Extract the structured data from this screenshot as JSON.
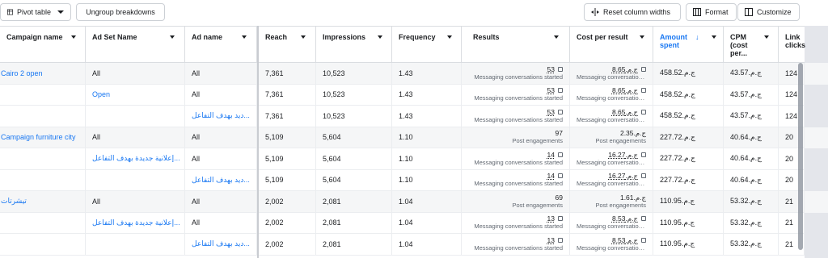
{
  "toolbar": {
    "pivot_label": "Pivot table",
    "ungroup_label": "Ungroup breakdowns",
    "reset_label": "Reset column widths",
    "format_label": "Format",
    "customize_label": "Customize"
  },
  "columns": {
    "campaign": "Campaign name",
    "adset": "Ad Set Name",
    "adname": "Ad name",
    "reach": "Reach",
    "impressions": "Impressions",
    "frequency": "Frequency",
    "results": "Results",
    "cpr": "Cost per result",
    "amount_l1": "Amount",
    "amount_l2": "spent",
    "cpm_l1": "CPM",
    "cpm_l2": "(cost",
    "cpm_l3": "per...",
    "link_l1": "Link",
    "link_l2": "clicks"
  },
  "rows": [
    {
      "campaign": "Cairo 2 open",
      "adset": "All",
      "adname": "All",
      "reach": "7,361",
      "impressions": "10,523",
      "frequency": "1.43",
      "results": "53",
      "results_sub": "Messaging conversations started",
      "cpr": "8.65ج.م.‏",
      "cpr_sub": "Messaging conversation...",
      "amount": "458.52ج.م.‏",
      "cpm": "43.57ج.م.‏",
      "link": "124"
    },
    {
      "campaign": "",
      "adset": "Open",
      "adname": "All",
      "reach": "7,361",
      "impressions": "10,523",
      "frequency": "1.43",
      "results": "53",
      "results_sub": "Messaging conversations started",
      "cpr": "8.65ج.م.‏",
      "cpr_sub": "Messaging conversation...",
      "amount": "458.52ج.م.‏",
      "cpm": "43.57ج.م.‏",
      "link": "124"
    },
    {
      "campaign": "",
      "adset": "",
      "adname": "ديد بهدف التفاعل...",
      "reach": "7,361",
      "impressions": "10,523",
      "frequency": "1.43",
      "results": "53",
      "results_sub": "Messaging conversations started",
      "cpr": "8.65ج.م.‏",
      "cpr_sub": "Messaging conversation...",
      "amount": "458.52ج.م.‏",
      "cpm": "43.57ج.م.‏",
      "link": "124"
    },
    {
      "campaign": "Campaign furniture city",
      "adset": "All",
      "adname": "All",
      "reach": "5,109",
      "impressions": "5,604",
      "frequency": "1.10",
      "results": "97",
      "results_sub": "Post engagements",
      "cpr": "2.35ج.م.‏",
      "cpr_sub": "Post engagements",
      "amount": "227.72ج.م.‏",
      "cpm": "40.64ج.م.‏",
      "link": "20"
    },
    {
      "campaign": "",
      "adset": "إعلانية جديدة بهدف التفاعل...",
      "adname": "All",
      "reach": "5,109",
      "impressions": "5,604",
      "frequency": "1.10",
      "results": "14",
      "results_sub": "Messaging conversations started",
      "cpr": "16.27ج.م.‏",
      "cpr_sub": "Messaging conversation...",
      "amount": "227.72ج.م.‏",
      "cpm": "40.64ج.م.‏",
      "link": "20"
    },
    {
      "campaign": "",
      "adset": "",
      "adname": "ديد بهدف التفاعل...",
      "reach": "5,109",
      "impressions": "5,604",
      "frequency": "1.10",
      "results": "14",
      "results_sub": "Messaging conversations started",
      "cpr": "16.27ج.م.‏",
      "cpr_sub": "Messaging conversation...",
      "amount": "227.72ج.م.‏",
      "cpm": "40.64ج.م.‏",
      "link": "20"
    },
    {
      "campaign": "تيشرتات",
      "adset": "All",
      "adname": "All",
      "reach": "2,002",
      "impressions": "2,081",
      "frequency": "1.04",
      "results": "69",
      "results_sub": "Post engagements",
      "cpr": "1.61ج.م.‏",
      "cpr_sub": "Post engagements",
      "amount": "110.95ج.م.‏",
      "cpm": "53.32ج.م.‏",
      "link": "21"
    },
    {
      "campaign": "",
      "adset": "إعلانية جديدة بهدف التفاعل...",
      "adname": "All",
      "reach": "2,002",
      "impressions": "2,081",
      "frequency": "1.04",
      "results": "13",
      "results_sub": "Messaging conversations started",
      "cpr": "8.53ج.م.‏",
      "cpr_sub": "Messaging conversation...",
      "amount": "110.95ج.م.‏",
      "cpm": "53.32ج.م.‏",
      "link": "21"
    },
    {
      "campaign": "",
      "adset": "",
      "adname": "ديد بهدف التفاعل...",
      "reach": "2,002",
      "impressions": "2,081",
      "frequency": "1.04",
      "results": "13",
      "results_sub": "Messaging conversations started",
      "cpr": "8.53ج.م.‏",
      "cpr_sub": "Messaging conversation...",
      "amount": "110.95ج.م.‏",
      "cpm": "53.32ج.م.‏",
      "link": "21"
    }
  ]
}
